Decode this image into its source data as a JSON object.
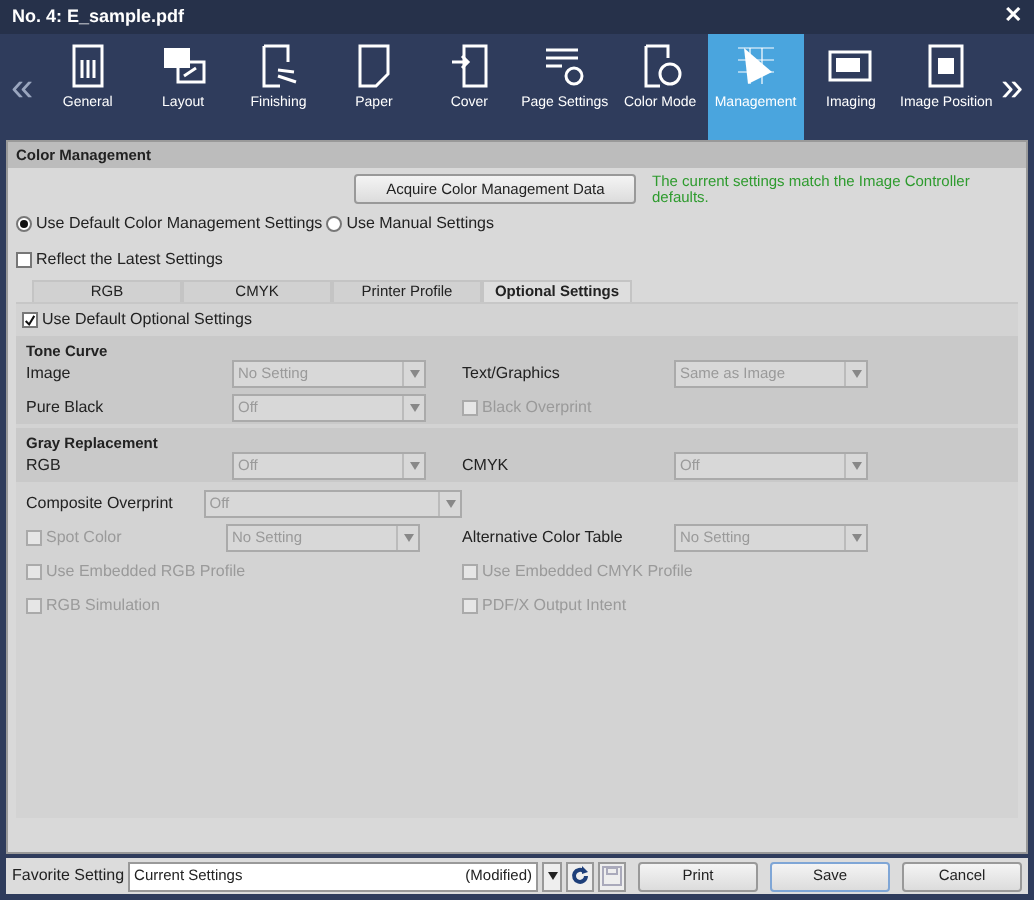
{
  "window": {
    "title": "No. 4: E_sample.pdf",
    "close": "✕"
  },
  "toolbar": {
    "prev": "«",
    "next": "»",
    "items": [
      {
        "label": "General",
        "selected": false
      },
      {
        "label": "Layout",
        "selected": false
      },
      {
        "label": "Finishing",
        "selected": false
      },
      {
        "label": "Paper",
        "selected": false
      },
      {
        "label": "Cover",
        "selected": false
      },
      {
        "label": "Page Settings",
        "selected": false
      },
      {
        "label": "Color Mode",
        "selected": false
      },
      {
        "label": "Management",
        "selected": true
      },
      {
        "label": "Imaging",
        "selected": false
      },
      {
        "label": "Image Position",
        "selected": false
      }
    ]
  },
  "section_title": "Color Management",
  "acquire_button": "Acquire Color Management Data",
  "status_message": "The current settings match the Image Controller defaults.",
  "mode_radios": [
    {
      "label": "Use Default Color Management Settings",
      "selected": true
    },
    {
      "label": "Use Manual Settings",
      "selected": false
    }
  ],
  "reflect_latest": {
    "label": "Reflect the Latest Settings",
    "checked": false
  },
  "subtabs": [
    {
      "label": "RGB",
      "selected": false
    },
    {
      "label": "CMYK",
      "selected": false
    },
    {
      "label": "Printer Profile",
      "selected": false
    },
    {
      "label": "Optional Settings",
      "selected": true
    }
  ],
  "use_default_optional": {
    "label": "Use Default Optional Settings",
    "checked": true
  },
  "sections": [
    {
      "title": "Tone Curve",
      "rows": [
        [
          {
            "kind": "select",
            "label": "Image",
            "value": "No Setting",
            "disabled": true
          },
          {
            "kind": "select",
            "label": "Text/Graphics",
            "value": "Same as Image",
            "disabled": true
          }
        ],
        [
          {
            "kind": "select",
            "label": "Pure Black",
            "value": "Off",
            "disabled": true
          },
          {
            "kind": "checkbox",
            "label": "Black Overprint",
            "checked": false,
            "disabled": true
          }
        ]
      ]
    },
    {
      "title": "Gray Replacement",
      "rows": [
        [
          {
            "kind": "select",
            "label": "RGB",
            "value": "Off",
            "disabled": true
          },
          {
            "kind": "select",
            "label": "CMYK",
            "value": "Off",
            "disabled": true
          }
        ]
      ]
    },
    {
      "rows": [
        [
          {
            "kind": "wide_select",
            "label": "Composite Overprint",
            "value": "Off",
            "disabled": true
          }
        ],
        [
          {
            "kind": "checkbox_select",
            "label": "Spot Color",
            "checked": false,
            "value": "No Setting",
            "disabled": true
          },
          {
            "kind": "select",
            "label": "Alternative Color Table",
            "value": "No Setting",
            "disabled": true
          }
        ],
        [
          {
            "kind": "checkbox",
            "label": "Use Embedded RGB Profile",
            "checked": false,
            "disabled": true
          },
          {
            "kind": "checkbox",
            "label": "Use Embedded CMYK Profile",
            "checked": false,
            "disabled": true
          }
        ],
        [
          {
            "kind": "checkbox",
            "label": "RGB Simulation",
            "checked": false,
            "disabled": true
          },
          {
            "kind": "checkbox",
            "label": "PDF/X Output Intent",
            "checked": false,
            "disabled": true
          }
        ]
      ]
    }
  ],
  "footer": {
    "favorite_label": "Favorite Setting",
    "favorite_value": "Current Settings",
    "favorite_note": "(Modified)",
    "save_icon_disabled": true,
    "buttons": [
      {
        "label": "Print",
        "default": false
      },
      {
        "label": "Save",
        "default": true
      },
      {
        "label": "Cancel",
        "default": false
      }
    ]
  }
}
